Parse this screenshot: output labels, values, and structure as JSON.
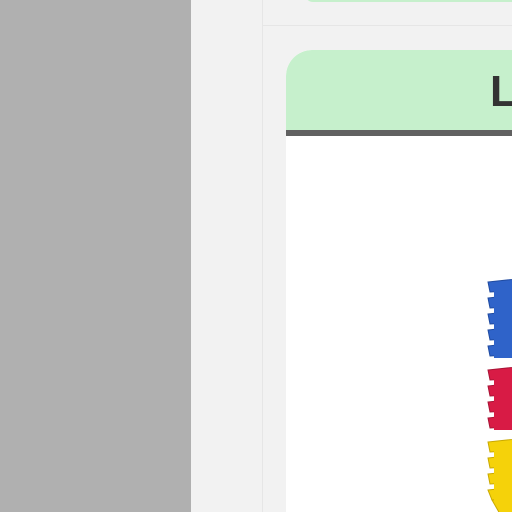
{
  "card": {
    "title": "L"
  },
  "product": {
    "icon": "stacked-plastic-bins-image",
    "colors": {
      "blue": "#2f63c9",
      "red": "#d81b45",
      "yellow": "#f5d20a"
    }
  },
  "colors": {
    "left_panel": "#b0b0b0",
    "background": "#f2f2f2",
    "header_green": "#c6f0cc",
    "header_border": "#616161"
  }
}
